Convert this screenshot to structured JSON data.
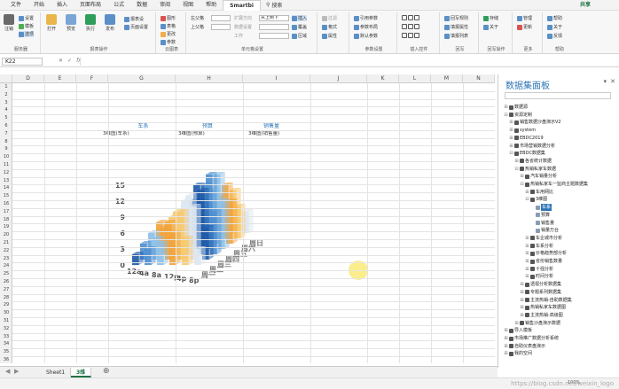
{
  "menubar": {
    "tabs": [
      "文件",
      "开始",
      "插入",
      "页面布局",
      "公式",
      "数据",
      "审阅",
      "视图",
      "帮助",
      "Smartbi"
    ],
    "active_tab": "Smartbi",
    "search_label": "搜索",
    "share_label": "共享"
  },
  "ribbon": {
    "groups": {
      "server": "服务器",
      "report_ops": "报表操作",
      "cloud": "云图表",
      "cell_settings": "单元格设置",
      "param_settings": "参数设置",
      "insert_controls": "插入控件",
      "writeback": "回写",
      "writeback_ops": "回写操作",
      "more": "更多",
      "help": "帮助"
    },
    "buttons": {
      "register": "注销",
      "settings": "设置",
      "template": "模板",
      "options": "选项",
      "open": "打开",
      "preview": "预览",
      "execute": "执行",
      "publish": "发布",
      "report_settings": "报表设",
      "page_settings": "页面设置",
      "graphic": "图形",
      "table": "表格",
      "change": "更改",
      "params": "参数",
      "up_label": "上父格",
      "left_label": "左父格",
      "expand_direction": "扩展方向",
      "data_settings": "数据设置",
      "tools": "工作",
      "top_to_bottom": "从上到下",
      "insert": "插入",
      "overwrite": "覆盖",
      "region": "区域",
      "filter": "过滤",
      "style": "格式",
      "attribute": "属性",
      "ref_param": "引用参数",
      "param_layout": "参数布局",
      "default_param": "默认参数",
      "writeback_rule": "回写规则",
      "fill_cell": "填报属性",
      "fill_list": "填报列表",
      "save_publish": "存储",
      "about": "关于",
      "manage": "管理",
      "update": "更新",
      "help": "帮助",
      "about2": "关于",
      "feedback": "反馈"
    }
  },
  "formula_bar": {
    "name_box": "K22",
    "formula": ""
  },
  "columns": [
    "D",
    "E",
    "F",
    "G",
    "H",
    "I",
    "J",
    "K",
    "L",
    "M",
    "N"
  ],
  "rows": [
    1,
    2,
    3,
    4,
    5,
    6,
    7,
    8,
    9,
    10,
    11,
    12,
    13,
    14,
    15,
    16,
    17,
    18,
    19,
    20,
    21,
    22,
    23,
    24,
    25,
    26,
    27,
    28,
    29,
    30,
    31,
    32,
    33,
    34,
    35,
    36
  ],
  "cells": {
    "g6": "车系",
    "h6": "预算",
    "i6": "销售量",
    "g7": "3维图(车系)",
    "h7": "3维图(预算)",
    "i7": "3维图(销售量)"
  },
  "chart_data": {
    "type": "bar",
    "subtype": "3d-bar",
    "ylim": [
      0,
      15
    ],
    "yticks": [
      0,
      3,
      6,
      9,
      12,
      15
    ],
    "categories": [
      "12a",
      "4a",
      "8a",
      "12p",
      "4p",
      "8p"
    ],
    "depth_labels": [
      "周一",
      "周二",
      "周三",
      "周四",
      "周五",
      "周六",
      "周日"
    ],
    "colors": [
      "#1f5ba8",
      "#4f8fd0",
      "#8ec0e8",
      "#f2a33c",
      "#f7c96f",
      "#dde7f2"
    ],
    "values": [
      [
        2,
        3,
        4,
        6,
        5,
        3
      ],
      [
        3,
        4,
        7,
        9,
        10,
        6
      ],
      [
        4,
        5,
        8,
        11,
        12,
        8
      ],
      [
        5,
        6,
        9,
        12,
        14,
        9
      ],
      [
        4,
        6,
        8,
        11,
        13,
        8
      ],
      [
        3,
        5,
        7,
        9,
        10,
        6
      ],
      [
        2,
        3,
        5,
        7,
        8,
        4
      ]
    ]
  },
  "pane": {
    "title": "数据集面板",
    "tree": [
      {
        "label": "数据源",
        "level": 0,
        "toggle": "+"
      },
      {
        "label": "资源定制",
        "level": 0,
        "toggle": "-"
      },
      {
        "label": "销售数据沙盘演示V2",
        "level": 1,
        "toggle": "+"
      },
      {
        "label": "system",
        "level": 1,
        "toggle": "+"
      },
      {
        "label": "EBDC2019",
        "level": 1,
        "toggle": "+"
      },
      {
        "label": "市场营销数据分析",
        "level": 1,
        "toggle": "+"
      },
      {
        "label": "EBDC数据集",
        "level": 1,
        "toggle": "-"
      },
      {
        "label": "各省统计数据",
        "level": 2,
        "toggle": "+"
      },
      {
        "label": "热销私家车数据",
        "level": 2,
        "toggle": "-"
      },
      {
        "label": "汽车销量分析",
        "level": 3,
        "toggle": "+"
      },
      {
        "label": "热销私家车一监商主题数据集",
        "level": 3,
        "toggle": "-"
      },
      {
        "label": "车用网比",
        "level": 4,
        "toggle": "+"
      },
      {
        "label": "3维图",
        "level": 4,
        "toggle": "-"
      },
      {
        "label": "车系",
        "level": 5,
        "toggle": "",
        "selected": true
      },
      {
        "label": "预算",
        "level": 5,
        "toggle": ""
      },
      {
        "label": "销售量",
        "level": 5,
        "toggle": ""
      },
      {
        "label": "销量万台",
        "level": 5,
        "toggle": ""
      },
      {
        "label": "车企城市分析",
        "level": 4,
        "toggle": "+"
      },
      {
        "label": "车系分析",
        "level": 4,
        "toggle": "+"
      },
      {
        "label": "价格趋势部分析",
        "level": 4,
        "toggle": "+"
      },
      {
        "label": "省份销售数量",
        "level": 4,
        "toggle": "+"
      },
      {
        "label": "十强分析",
        "level": 4,
        "toggle": "+"
      },
      {
        "label": "时间分析",
        "level": 4,
        "toggle": "+"
      },
      {
        "label": "透视分析数据集",
        "level": 3,
        "toggle": "+"
      },
      {
        "label": "专题系列数据集",
        "level": 3,
        "toggle": "+"
      },
      {
        "label": "主流热销-自助数据集",
        "level": 3,
        "toggle": "+"
      },
      {
        "label": "热销私家车数据图",
        "level": 3,
        "toggle": "+"
      },
      {
        "label": "主流热销-高级图",
        "level": 3,
        "toggle": "+"
      },
      {
        "label": "销售沙盘演示数据",
        "level": 2,
        "toggle": "+"
      },
      {
        "label": "导入模板",
        "level": 0,
        "toggle": "+"
      },
      {
        "label": "市场推广数据分析系统",
        "level": 0,
        "toggle": "+"
      },
      {
        "label": "自助仪表盘演示",
        "level": 0,
        "toggle": "+"
      },
      {
        "label": "我的空间",
        "level": 0,
        "toggle": "+"
      }
    ]
  },
  "sheets": [
    "Sheet1",
    "3维"
  ],
  "active_sheet": "3维",
  "status": {
    "zoom": "100%",
    "watermark": "https://blog.csdn.net/weixin_logo"
  }
}
